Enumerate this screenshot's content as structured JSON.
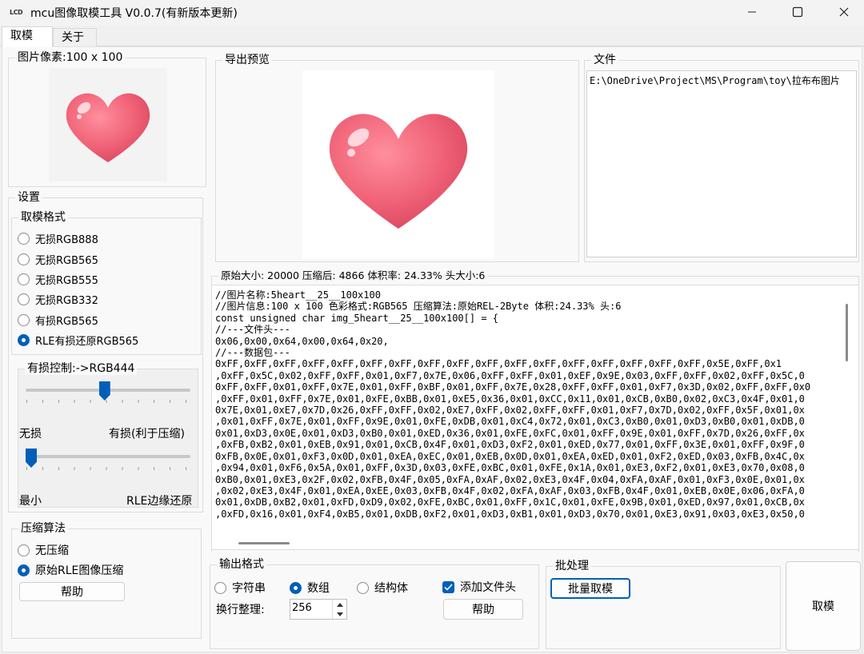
{
  "window": {
    "app_icon": "LCD",
    "title": "mcu图像取模工具 V0.0.7(有新版本更新)",
    "controls": [
      "minimize-icon",
      "maximize-icon",
      "close-icon"
    ]
  },
  "tabs": [
    "取模",
    "关于"
  ],
  "image_panel": {
    "legend": "图片像素:100 x 100"
  },
  "preview_panel": {
    "legend": "导出预览"
  },
  "file_panel": {
    "legend": "文件",
    "path": "E:\\OneDrive\\Project\\MS\\Program\\toy\\拉布布图片"
  },
  "settings": {
    "legend": "设置",
    "format_legend": "取模格式",
    "formats": [
      "无损RGB888",
      "无损RGB565",
      "无损RGB555",
      "无损RGB332",
      "有损RGB565",
      "RLE有损还原RGB565"
    ],
    "format_selected": 5,
    "lossy_legend": "有损控制:->RGB444",
    "lossy_slider_value": 0.28,
    "lossy_min_label": "无损",
    "lossy_max_label": "有损(利于压缩)",
    "edge_slider_value": 0.0,
    "edge_min_label": "最小",
    "edge_max_label": "RLE边缘还原"
  },
  "compression": {
    "legend": "压缩算法",
    "options": [
      "无压缩",
      "原始RLE图像压缩"
    ],
    "selected": 1,
    "help_label": "帮助"
  },
  "stats": "原始大小: 20000 压缩后: 4866 体积率: 24.33%  头大小:6",
  "code_lines": [
    "//图片名称:5heart__25__100x100",
    "//图片信息:100 x 100 色彩格式:RGB565 压缩算法:原始REL-2Byte 体积:24.33% 头:6",
    "const unsigned char img_5heart__25__100x100[] = {",
    "//---文件头---",
    "0x06,0x00,0x64,0x00,0x64,0x20,",
    "//---数据包---",
    "0xFF,0xFF,0xFF,0xFF,0xFF,0xFF,0xFF,0xFF,0xFF,0xFF,0xFF,0xFF,0xFF,0xFF,0xFF,0xFF,0xFF,0x5E,0xFF,0x1",
    ",0xFF,0x5C,0x02,0xFF,0xFF,0x01,0xF7,0x7E,0x06,0xFF,0xFF,0x01,0xEF,0x9E,0x03,0xFF,0xFF,0x02,0xFF,0x5C,0",
    "0xFF,0xFF,0x01,0xFF,0x7E,0x01,0xFF,0xBF,0x01,0xFF,0x7E,0x28,0xFF,0xFF,0x01,0xF7,0x3D,0x02,0xFF,0xFF,0x0",
    ",0xFF,0x01,0xFF,0x7E,0x01,0xFE,0xBB,0x01,0xE5,0x36,0x01,0xCC,0x11,0x01,0xCB,0xB0,0x02,0xC3,0x4F,0x01,0",
    "0x7E,0x01,0xE7,0x7D,0x26,0xFF,0xFF,0x02,0xE7,0xFF,0x02,0xFF,0xFF,0x01,0xF7,0x7D,0x02,0xFF,0x5F,0x01,0x",
    ",0x01,0xFF,0x7E,0x01,0xFF,0x9E,0x01,0xFE,0xDB,0x01,0xC4,0x72,0x01,0xC3,0xB0,0x01,0xD3,0xB0,0x01,0xDB,0",
    "0x01,0xD3,0x0E,0x01,0xD3,0xB0,0x01,0xED,0x36,0x01,0xFE,0xFC,0x01,0xFF,0x9E,0x01,0xFF,0x7D,0x26,0xFF,0x",
    ",0xFB,0xB2,0x01,0xEB,0x91,0x01,0xCB,0x4F,0x01,0xD3,0xF2,0x01,0xED,0x77,0x01,0xFF,0x3E,0x01,0xFF,0x9F,0",
    "0xFB,0x0E,0x01,0xF3,0x0D,0x01,0xEA,0xEC,0x01,0xEB,0x0D,0x01,0xEA,0xED,0x01,0xF2,0xED,0x03,0xFB,0x4C,0x",
    ",0x94,0x01,0xF6,0x5A,0x01,0xFF,0x3D,0x03,0xFE,0xBC,0x01,0xFE,0x1A,0x01,0xE3,0xF2,0x01,0xE3,0x70,0x08,0",
    "0xB0,0x01,0xE3,0x2F,0x02,0xFB,0x4F,0x05,0xFA,0xAF,0x02,0xE3,0x4F,0x04,0xFA,0xAF,0x01,0xF3,0x0E,0x01,0x",
    ",0x02,0xE3,0x4F,0x01,0xEA,0xEE,0x03,0xFB,0x4F,0x02,0xFA,0xAF,0x03,0xFB,0x4F,0x01,0xEB,0x0E,0x06,0xFA,0",
    "0x01,0xDB,0xB2,0x01,0xFD,0xD9,0x02,0xFE,0xBC,0x01,0xFF,0x1C,0x01,0xFE,0x9B,0x01,0xED,0x97,0x01,0xCB,0x",
    ",0xFD,0x16,0x01,0xF4,0xB5,0x01,0xDB,0xF2,0x01,0xD3,0xB1,0x01,0xD3,0x70,0x01,0xE3,0x91,0x03,0xE3,0x50,0"
  ],
  "output_format": {
    "legend": "输出格式",
    "options": [
      "字符串",
      "数组",
      "结构体"
    ],
    "selected": 1,
    "add_header_label": "添加文件头",
    "add_header_checked": true,
    "wrap_label": "换行整理:",
    "wrap_value": "256",
    "help_label": "帮助"
  },
  "batch": {
    "legend": "批处理",
    "button_label": "批量取模"
  },
  "main_action_label": "取模"
}
